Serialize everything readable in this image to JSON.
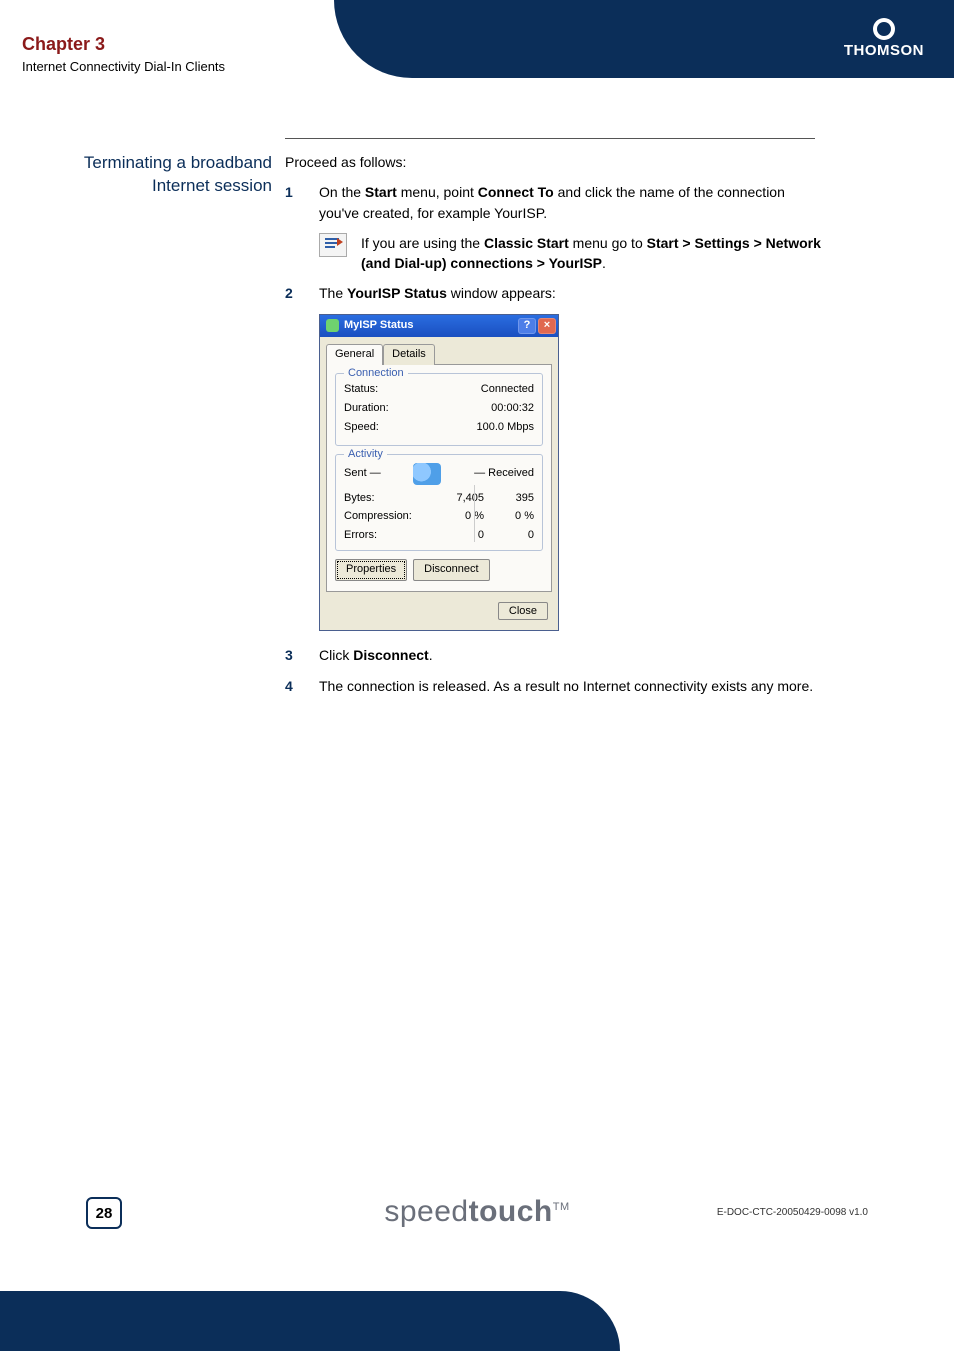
{
  "header": {
    "chapter_title": "Chapter 3",
    "chapter_subtitle": "Internet Connectivity Dial-In Clients",
    "brand": "THOMSON"
  },
  "side_heading": "Terminating a broadband Internet session",
  "lead": "Proceed as follows:",
  "steps": {
    "s1": {
      "num": "1",
      "pre": "On the ",
      "b1": "Start",
      "mid1": " menu, point ",
      "b2": "Connect To",
      "post": " and click the name of the connection you've created, for example YourISP."
    },
    "note": {
      "pre": "If you are using the ",
      "b1": "Classic Start",
      "mid": " menu go to ",
      "b2": "Start > Settings > Network (and Dial-up) connections > YourISP",
      "post": "."
    },
    "s2": {
      "num": "2",
      "pre": "The ",
      "b1": "YourISP Status",
      "post": " window appears:"
    },
    "s3": {
      "num": "3",
      "pre": "Click ",
      "b1": "Disconnect",
      "post": "."
    },
    "s4": {
      "num": "4",
      "text": "The connection is released. As a result no Internet connectivity exists any more."
    }
  },
  "dialog": {
    "title": "MyISP Status",
    "tabs": {
      "general": "General",
      "details": "Details"
    },
    "connection": {
      "legend": "Connection",
      "status_label": "Status:",
      "status_value": "Connected",
      "duration_label": "Duration:",
      "duration_value": "00:00:32",
      "speed_label": "Speed:",
      "speed_value": "100.0 Mbps"
    },
    "activity": {
      "legend": "Activity",
      "sent": "Sent",
      "received": "Received",
      "bytes_label": "Bytes:",
      "bytes_sent": "7,405",
      "bytes_received": "395",
      "compression_label": "Compression:",
      "compression_sent": "0 %",
      "compression_received": "0 %",
      "errors_label": "Errors:",
      "errors_sent": "0",
      "errors_received": "0"
    },
    "buttons": {
      "properties": "Properties",
      "disconnect": "Disconnect",
      "close": "Close"
    }
  },
  "footer": {
    "page": "28",
    "brand_thin": "speed",
    "brand_bold": "touch",
    "tm": "TM",
    "docref": "E-DOC-CTC-20050429-0098 v1.0"
  }
}
